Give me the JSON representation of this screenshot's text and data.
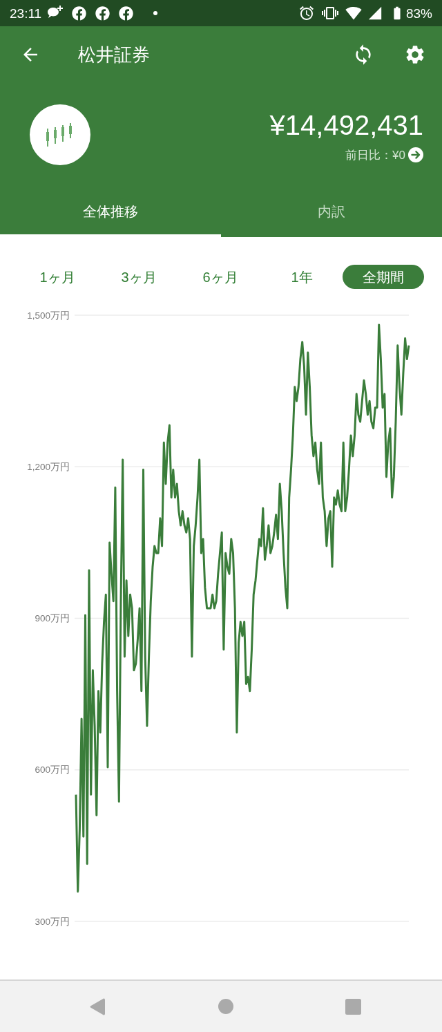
{
  "status_bar": {
    "time": "23:11",
    "battery": "83%"
  },
  "app_bar": {
    "title": "松井証券"
  },
  "summary": {
    "total": "¥14,492,431",
    "change": "前日比：¥0"
  },
  "tabs": [
    {
      "label": "全体推移",
      "selected": true
    },
    {
      "label": "内訳",
      "selected": false
    }
  ],
  "periods": [
    {
      "label": "1ヶ月",
      "selected": false
    },
    {
      "label": "3ヶ月",
      "selected": false
    },
    {
      "label": "6ヶ月",
      "selected": false
    },
    {
      "label": "1年",
      "selected": false
    },
    {
      "label": "全期間",
      "selected": true
    }
  ],
  "chart": {
    "chart_data": {
      "type": "line",
      "grid": true,
      "ylim": [
        300,
        1500
      ],
      "yticks": [
        {
          "value": 300,
          "label": "300万円"
        },
        {
          "value": 600,
          "label": "600万円"
        },
        {
          "value": 900,
          "label": "900万円"
        },
        {
          "value": 1200,
          "label": "1,200万円"
        },
        {
          "value": 1500,
          "label": "1,500万円"
        }
      ],
      "series": [
        {
          "color": "#3a7d3a",
          "values": [
            551,
            359,
            482,
            701,
            468,
            906,
            414,
            995,
            551,
            797,
            687,
            510,
            756,
            674,
            810,
            893,
            947,
            605,
            1050,
            988,
            934,
            1159,
            756,
            537,
            934,
            1214,
            824,
            975,
            865,
            947,
            920,
            797,
            810,
            858,
            920,
            756,
            1194,
            824,
            687,
            824,
            934,
            1002,
            1043,
            1029,
            1029,
            1098,
            1043,
            1248,
            1166,
            1248,
            1282,
            1139,
            1194,
            1139,
            1166,
            1112,
            1084,
            1112,
            1084,
            1070,
            1098,
            1057,
            824,
            1043,
            1084,
            1139,
            1214,
            1029,
            1057,
            961,
            920,
            920,
            920,
            947,
            920,
            934,
            988,
            1029,
            1070,
            838,
            1029,
            1002,
            988,
            1057,
            1029,
            920,
            674,
            852,
            893,
            865,
            893,
            770,
            784,
            756,
            838,
            947,
            975,
            1016,
            1057,
            1043,
            1118,
            1016,
            1043,
            1084,
            1029,
            1043,
            1070,
            1105,
            1057,
            1166,
            1112,
            1029,
            961,
            920,
            1139,
            1194,
            1262,
            1358,
            1330,
            1358,
            1413,
            1447,
            1399,
            1303,
            1426,
            1358,
            1262,
            1221,
            1248,
            1194,
            1166,
            1248,
            1139,
            1112,
            1043,
            1098,
            1112,
            1002,
            1139,
            1125,
            1153,
            1125,
            1112,
            1248,
            1112,
            1139,
            1194,
            1262,
            1221,
            1262,
            1344,
            1303,
            1289,
            1330,
            1371,
            1344,
            1303,
            1330,
            1289,
            1276,
            1317,
            1317,
            1481,
            1413,
            1317,
            1344,
            1180,
            1248,
            1276,
            1139,
            1180,
            1289,
            1440,
            1358,
            1303,
            1385,
            1454,
            1413,
            1440
          ]
        }
      ]
    }
  }
}
